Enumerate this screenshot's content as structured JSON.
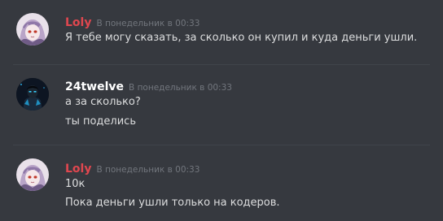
{
  "colors": {
    "background": "#36393f",
    "username_loly": "#e0474f",
    "username_24twelve": "#ffffff",
    "timestamp": "#72767d",
    "message_text": "#dcddde"
  },
  "messages": [
    {
      "author": "Loly",
      "timestamp": "В понедельник в 00:33",
      "avatar_icon": "anime-girl-avatar-icon",
      "lines": [
        "Я тебе могу сказать, за сколько он купил и куда деньги ушли."
      ]
    },
    {
      "author": "24twelve",
      "timestamp": "В понедельник в 00:33",
      "avatar_icon": "dark-figure-avatar-icon",
      "lines": [
        "а за сколько?",
        "ты поделись"
      ]
    },
    {
      "author": "Loly",
      "timestamp": "В понедельник в 00:33",
      "avatar_icon": "anime-girl-avatar-icon",
      "lines": [
        "10к",
        "Пока деньги ушли только на кодеров."
      ]
    }
  ]
}
